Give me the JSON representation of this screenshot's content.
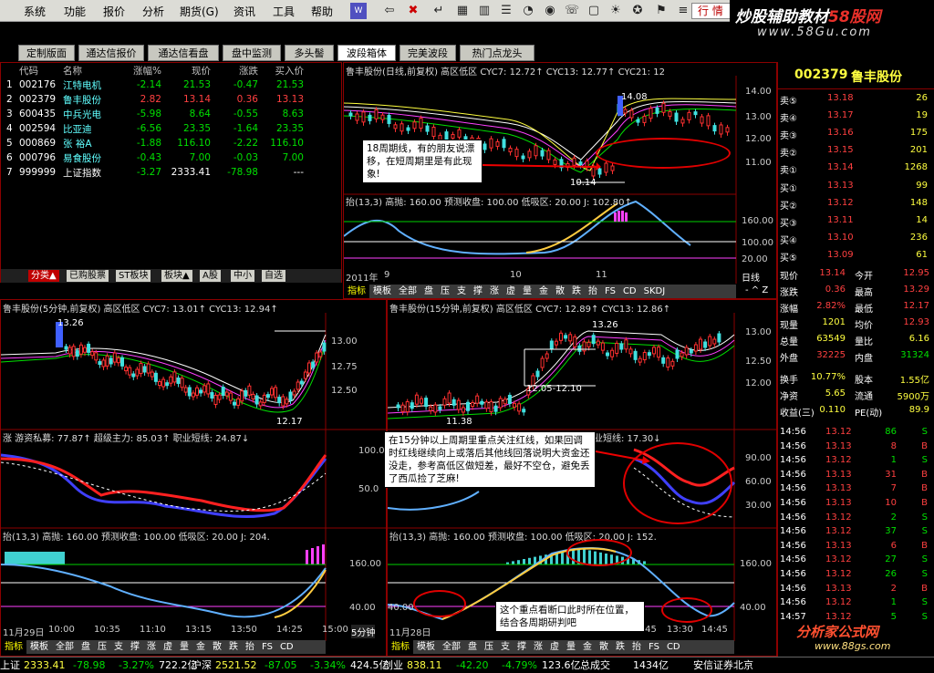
{
  "menu": [
    "系统",
    "功能",
    "报价",
    "分析",
    "期货(G)",
    "资讯",
    "工具",
    "帮助"
  ],
  "search_text": "行 情",
  "brand": {
    "line1a": "炒股辅助教材",
    "line1b": "58股网",
    "line2": "www.58Gu.com"
  },
  "tabs": [
    "定制版面",
    "通达信报价",
    "通达信看盘",
    "盘中监测",
    "多头髻",
    "波段箱体",
    "完美波段",
    "热门点龙头"
  ],
  "active_tab": 5,
  "stock_table": {
    "headers": [
      "",
      "代码",
      "名称",
      "涨幅%",
      "现价",
      "涨跌",
      "买入价"
    ],
    "rows": [
      [
        "1",
        "002176",
        "江特电机",
        "-2.14",
        "21.53",
        "-0.47",
        "21.53"
      ],
      [
        "2",
        "002379",
        "鲁丰股份",
        "2.82",
        "13.14",
        "0.36",
        "13.13"
      ],
      [
        "3",
        "600435",
        "中兵光电",
        "-5.98",
        "8.64",
        "-0.55",
        "8.63"
      ],
      [
        "4",
        "002594",
        "比亚迪",
        "-6.56",
        "23.35",
        "-1.64",
        "23.35"
      ],
      [
        "5",
        "000869",
        "张  裕A",
        "-1.88",
        "116.10",
        "-2.22",
        "116.10"
      ],
      [
        "6",
        "000796",
        "易食股份",
        "-0.43",
        "7.00",
        "-0.03",
        "7.00"
      ],
      [
        "7",
        "999999",
        "上证指数",
        "-3.27",
        "2333.41",
        "-78.98",
        "---"
      ]
    ]
  },
  "cat_tabs": [
    "分类▲",
    "已购股票",
    "ST板块",
    "板块▲",
    "A股",
    "中小",
    "自选"
  ],
  "daily": {
    "title": "鲁丰股份(日线,前复权) 高区低区 CYC7: 12.72↑ CYC13: 12.77↑ CYC21: 12",
    "y": [
      "14.00",
      "13.00",
      "12.00",
      "11.00"
    ],
    "high": "14.08",
    "low": "10.14",
    "ind_title": "抬(13,3) 高抛: 160.00 预测收盘: 100.00 低吸区: 20.00 J: 102.80↑",
    "ind_y": [
      "160.00",
      "100.00",
      "20.00"
    ],
    "x": [
      "2011年",
      "9",
      "10",
      "11"
    ],
    "period": "日线",
    "note": "18周期线，有的朋友说漂移，在短周期里是有此现象!",
    "strip": [
      "指标",
      "模板",
      "全部",
      "盘",
      "压",
      "支",
      "撑",
      "涨",
      "虚",
      "量",
      "金",
      "散",
      "跌",
      "抬",
      "FS",
      "CD",
      "SKDJ"
    ]
  },
  "m5": {
    "title": "鲁丰股份(5分钟,前复权) 高区低区 CYC7: 13.01↑ CYC13: 12.94↑",
    "y": [
      "13.00",
      "12.75",
      "12.50"
    ],
    "high": "13.26",
    "low": "12.17",
    "ind2_title": "涨 游资私募: 77.87↑ 超级主力: 85.03↑ 职业短线: 24.87↓",
    "ind2_y": [
      "100.0",
      "50.0"
    ],
    "ind3_title": "抬(13,3) 高抛: 160.00 预测收盘: 100.00 低吸区: 20.00 J: 204.",
    "ind3_y": [
      "160.00",
      "40.00"
    ],
    "x": [
      "11月29日",
      "10:00",
      "10:35",
      "11:10",
      "13:15",
      "13:50",
      "14:25",
      "15:00"
    ],
    "period": "5分钟",
    "strip": [
      "指标",
      "模板",
      "全部",
      "盘",
      "压",
      "支",
      "撑",
      "涨",
      "虚",
      "量",
      "金",
      "散",
      "跌",
      "抬",
      "FS",
      "CD"
    ]
  },
  "m15": {
    "title": "鲁丰股份(15分钟,前复权) 高区低区 CYC7: 12.89↑ CYC13: 12.86↑",
    "y": [
      "13.00",
      "12.50",
      "12.00"
    ],
    "high": "13.26",
    "low": "11.38",
    "range": "12.05-12.10",
    "ind2_title": "业短线: 17.30↓",
    "ind2_y": [
      "90.00",
      "60.00",
      "30.00"
    ],
    "ind3_title": "抬(13,3) 高抛: 160.00 预测收盘: 100.00 低吸区: 20.00 J: 152.",
    "ind3_y": [
      "160.00",
      "40.00",
      "40.00"
    ],
    "x": [
      "11月28日",
      "13:45",
      "13:30",
      "14:45"
    ],
    "note1": "在15分钟以上周期里重点关注红线，如果回调时红线继续向上或落后其他线回落说明大资金还没走，参考高低区做短差，最好不空仓，避免丢了西瓜捡了芝麻!",
    "note2": "这个重点看断口此时所在位置，结合各周期研判吧",
    "strip": [
      "指标",
      "模板",
      "全部",
      "盘",
      "压",
      "支",
      "撑",
      "涨",
      "虚",
      "量",
      "金",
      "散",
      "跌",
      "抬",
      "FS",
      "CD"
    ]
  },
  "quote": {
    "code": "002379",
    "name": "鲁丰股份",
    "asks": [
      [
        "卖⑤",
        "13.18",
        "26"
      ],
      [
        "卖④",
        "13.17",
        "19"
      ],
      [
        "卖③",
        "13.16",
        "175"
      ],
      [
        "卖②",
        "13.15",
        "201"
      ],
      [
        "卖①",
        "13.14",
        "1268"
      ]
    ],
    "bids": [
      [
        "买①",
        "13.13",
        "99"
      ],
      [
        "买②",
        "13.12",
        "148"
      ],
      [
        "买③",
        "13.11",
        "14"
      ],
      [
        "买④",
        "13.10",
        "236"
      ],
      [
        "买⑤",
        "13.09",
        "61"
      ]
    ],
    "stats": [
      [
        "现价",
        "13.14",
        "今开",
        "12.95"
      ],
      [
        "涨跌",
        "0.36",
        "最高",
        "13.29"
      ],
      [
        "涨幅",
        "2.82%",
        "最低",
        "12.17"
      ],
      [
        "现量",
        "1201",
        "均价",
        "12.93"
      ],
      [
        "总量",
        "63549",
        "量比",
        "6.16"
      ],
      [
        "外盘",
        "32225",
        "内盘",
        "31324"
      ],
      [
        "换手",
        "10.77%",
        "股本",
        "1.55亿"
      ],
      [
        "净资",
        "5.65",
        "流通",
        "5900万"
      ],
      [
        "收益(三)",
        "0.110",
        "PE(动)",
        "89.9"
      ]
    ],
    "ticks": [
      [
        "14:56",
        "13.12",
        "86",
        "S"
      ],
      [
        "14:56",
        "13.13",
        "8",
        "B"
      ],
      [
        "14:56",
        "13.12",
        "1",
        "S"
      ],
      [
        "14:56",
        "13.13",
        "31",
        "B"
      ],
      [
        "14:56",
        "13.13",
        "7",
        "B"
      ],
      [
        "14:56",
        "13.13",
        "10",
        "B"
      ],
      [
        "14:56",
        "13.12",
        "2",
        "S"
      ],
      [
        "14:56",
        "13.12",
        "37",
        "S"
      ],
      [
        "14:56",
        "13.13",
        "6",
        "B"
      ],
      [
        "14:56",
        "13.12",
        "27",
        "S"
      ],
      [
        "14:56",
        "13.12",
        "26",
        "S"
      ],
      [
        "14:56",
        "13.13",
        "2",
        "B"
      ],
      [
        "14:56",
        "13.12",
        "1",
        "S"
      ],
      [
        "14:57",
        "13.12",
        "5",
        "S"
      ]
    ],
    "watermark1": "分析家公式网",
    "watermark2": "www.88gs.com"
  },
  "bottom": [
    [
      "上证",
      "2333.41",
      "-78.98",
      "-3.27%",
      "722.2亿"
    ],
    [
      "沪深",
      "2521.52",
      "-87.05",
      "-3.34%",
      "424.5亿"
    ],
    [
      "创业",
      "838.11",
      "-42.20",
      "-4.79%",
      "123.6亿"
    ]
  ],
  "bottom_extra": [
    "总成交",
    "1434亿",
    "安信证券北京"
  ]
}
